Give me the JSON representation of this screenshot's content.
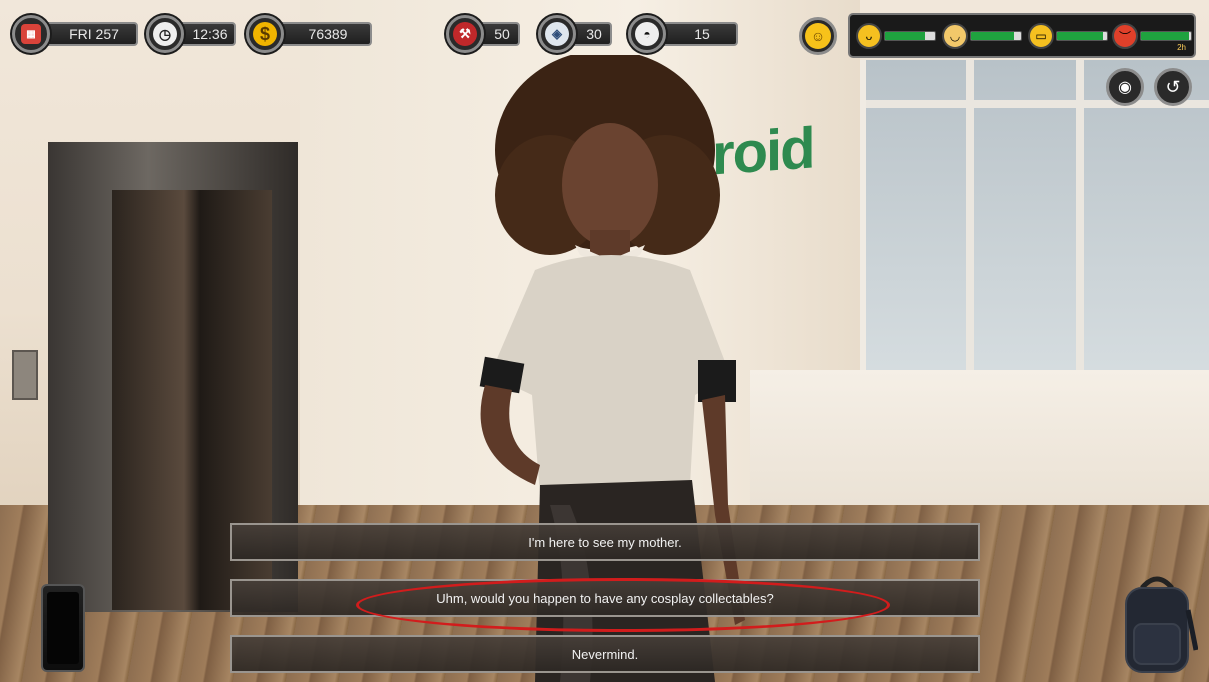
{
  "hud": {
    "day": "FRI 257",
    "time": "12:36",
    "money_symbol": "$",
    "money": "76389",
    "stat_1": "50",
    "stat_2": "30",
    "stat_3": "15",
    "timer_badge": "2h"
  },
  "mood": {
    "meters": [
      {
        "icon": "sleepy-face-icon",
        "level": 0.8
      },
      {
        "icon": "hungry-face-icon",
        "level": 0.85
      },
      {
        "icon": "sick-face-icon",
        "level": 0.92
      },
      {
        "icon": "angry-face-icon",
        "level": 0.95
      }
    ]
  },
  "scene": {
    "wall_logo_text": "roid",
    "wall_logo_color": "#2e8a4f"
  },
  "dialogue": {
    "choices": [
      "I'm here to see my mother.",
      "Uhm, would you happen to have any cosplay collectables?",
      "Nevermind."
    ],
    "highlighted_choice": 1,
    "highlight_color": "#d21c1c"
  },
  "colors": {
    "hud_border": "#8c8c8c",
    "bar_green": "#1fa23f",
    "money_gold": "#f0b400"
  }
}
